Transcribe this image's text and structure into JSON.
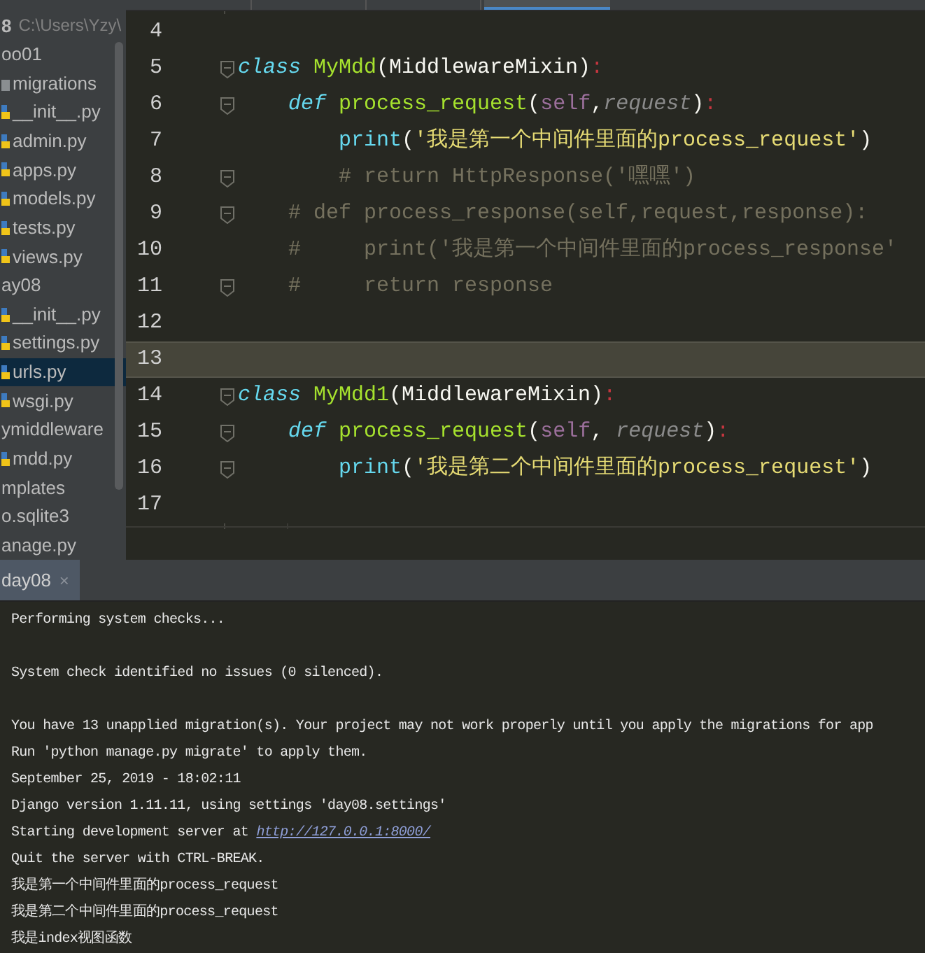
{
  "editor_tabs": [
    {
      "selected": false
    },
    {
      "selected": false
    },
    {
      "selected": false
    },
    {
      "selected": true
    }
  ],
  "sidebar": {
    "tree": [
      {
        "label": "8",
        "path": "C:\\Users\\Yzy\\",
        "kind": "root",
        "selected": false
      },
      {
        "label": "oo01",
        "kind": "folder",
        "selected": false,
        "children": [
          {
            "label": "migrations",
            "kind": "folder",
            "selected": false
          },
          {
            "label": "__init__.py",
            "kind": "python",
            "selected": false
          },
          {
            "label": "admin.py",
            "kind": "python",
            "selected": false
          },
          {
            "label": "apps.py",
            "kind": "python",
            "selected": false
          },
          {
            "label": "models.py",
            "kind": "python",
            "selected": false
          },
          {
            "label": "tests.py",
            "kind": "python",
            "selected": false
          },
          {
            "label": "views.py",
            "kind": "python",
            "selected": false
          }
        ]
      },
      {
        "label": "ay08",
        "kind": "folder",
        "selected": false,
        "children": [
          {
            "label": "__init__.py",
            "kind": "python",
            "selected": false
          },
          {
            "label": "settings.py",
            "kind": "python",
            "selected": false
          },
          {
            "label": "urls.py",
            "kind": "python",
            "selected": true
          },
          {
            "label": "wsgi.py",
            "kind": "python",
            "selected": false
          }
        ]
      },
      {
        "label": "ymiddleware",
        "kind": "folder",
        "selected": false,
        "children": [
          {
            "label": "mdd.py",
            "kind": "python",
            "selected": false
          }
        ]
      },
      {
        "label": "mplates",
        "kind": "folder",
        "selected": false
      },
      {
        "label": "o.sqlite3",
        "kind": "file",
        "selected": false
      },
      {
        "label": "anage.py",
        "kind": "file",
        "selected": false
      }
    ]
  },
  "editor": {
    "lines": [
      {
        "number": "4",
        "current": false,
        "fold": false
      },
      {
        "number": "5",
        "current": false,
        "fold": true,
        "tokens": [
          {
            "text": "class",
            "kind": "keyword"
          },
          {
            "text": " MyMdd",
            "kind": "classname"
          },
          {
            "text": "(MiddlewareMixin)",
            "kind": "plain"
          },
          {
            "text": ":",
            "kind": "colon"
          }
        ]
      },
      {
        "number": "6",
        "current": false,
        "fold": true,
        "tokens": [
          {
            "text": "    def",
            "kind": "keyword"
          },
          {
            "text": " process_request",
            "kind": "function"
          },
          {
            "text": "(",
            "kind": "plain"
          },
          {
            "text": "self",
            "kind": "self"
          },
          {
            "text": ",",
            "kind": "plain"
          },
          {
            "text": "request",
            "kind": "param"
          },
          {
            "text": ")",
            "kind": "plain"
          },
          {
            "text": ":",
            "kind": "colon"
          }
        ]
      },
      {
        "number": "7",
        "current": false,
        "fold": false,
        "tokens": [
          {
            "text": "        print",
            "kind": "builtin"
          },
          {
            "text": "(",
            "kind": "plain"
          },
          {
            "text": "'我是第一个中间件里面的process_request'",
            "kind": "string"
          },
          {
            "text": ")",
            "kind": "plain"
          }
        ]
      },
      {
        "number": "8",
        "current": false,
        "fold": true,
        "tokens": [
          {
            "text": "        # return HttpResponse('嘿嘿')",
            "kind": "comment"
          }
        ]
      },
      {
        "number": "9",
        "current": false,
        "fold": true,
        "tokens": [
          {
            "text": "    # def process_response(self,request,response):",
            "kind": "comment"
          }
        ]
      },
      {
        "number": "10",
        "current": false,
        "fold": false,
        "tokens": [
          {
            "text": "    #     print('我是第一个中间件里面的process_response'",
            "kind": "comment"
          }
        ]
      },
      {
        "number": "11",
        "current": false,
        "fold": true,
        "tokens": [
          {
            "text": "    #     return response",
            "kind": "comment"
          }
        ]
      },
      {
        "number": "12",
        "current": false,
        "fold": false
      },
      {
        "number": "13",
        "current": true,
        "fold": false
      },
      {
        "number": "14",
        "current": false,
        "fold": true,
        "tokens": [
          {
            "text": "class",
            "kind": "keyword"
          },
          {
            "text": " MyMdd1",
            "kind": "classname"
          },
          {
            "text": "(MiddlewareMixin)",
            "kind": "plain"
          },
          {
            "text": ":",
            "kind": "colon"
          }
        ]
      },
      {
        "number": "15",
        "current": false,
        "fold": true,
        "tokens": [
          {
            "text": "    def",
            "kind": "keyword"
          },
          {
            "text": " process_request",
            "kind": "function"
          },
          {
            "text": "(",
            "kind": "plain"
          },
          {
            "text": "self",
            "kind": "self"
          },
          {
            "text": ",",
            "kind": "plain"
          },
          {
            "text": " request",
            "kind": "param"
          },
          {
            "text": ")",
            "kind": "plain"
          },
          {
            "text": ":",
            "kind": "colon"
          }
        ]
      },
      {
        "number": "16",
        "current": false,
        "fold": true,
        "tokens": [
          {
            "text": "        print",
            "kind": "builtin"
          },
          {
            "text": "(",
            "kind": "plain"
          },
          {
            "text": "'我是第二个中间件里面的process_request'",
            "kind": "string"
          },
          {
            "text": ")",
            "kind": "plain"
          }
        ]
      },
      {
        "number": "17",
        "current": false,
        "fold": false
      }
    ]
  },
  "run_panel": {
    "tab": {
      "label": "day08",
      "selected": true,
      "close": "×"
    },
    "console": [
      {
        "lines": [
          {
            "text": "Performing system checks..."
          }
        ]
      },
      {
        "lines": [
          {
            "text": "System check identified no issues (0 silenced)."
          }
        ]
      },
      {
        "lines": [
          {
            "text": "You have 13 unapplied migration(s). Your project may not work properly until you apply the migrations for app"
          },
          {
            "text": "Run 'python manage.py migrate' to apply them."
          },
          {
            "text": "September 25, 2019 - 18:02:11"
          },
          {
            "text": "Django version 1.11.11, using settings 'day08.settings'"
          },
          {
            "text": "Starting development server at ",
            "link": "http://127.0.0.1:8000/"
          },
          {
            "text": "Quit the server with CTRL-BREAK."
          },
          {
            "text": "我是第一个中间件里面的process_request"
          },
          {
            "text": "我是第二个中间件里面的process_request"
          },
          {
            "text": "我是index视图函数"
          }
        ]
      }
    ]
  }
}
